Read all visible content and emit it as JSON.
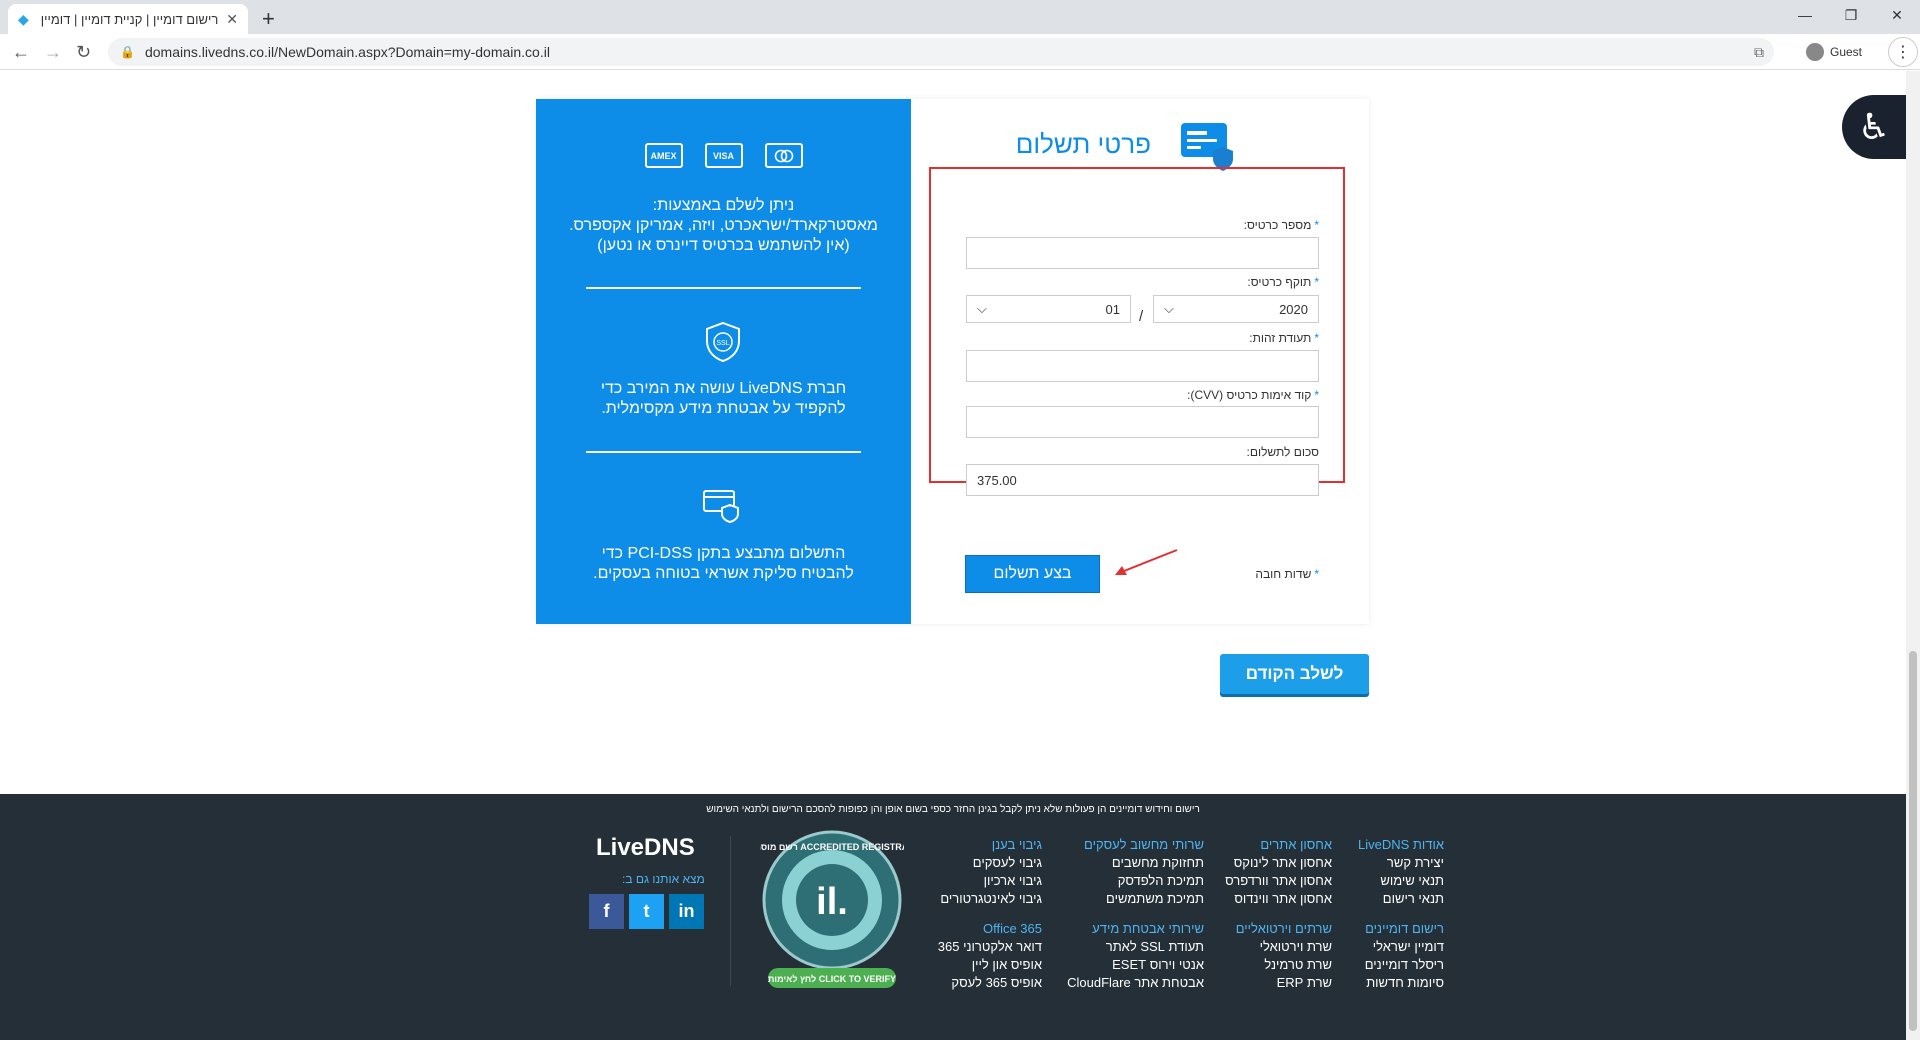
{
  "browser": {
    "tab_title": "רישום דומיין | קניית דומיין | דומיין ישראלי",
    "tab_favicon": "livedns-favicon",
    "url": "domains.livedns.co.il/NewDomain.aspx?Domain=my-domain.co.il",
    "profile_label": "Guest"
  },
  "info_panel": {
    "card_logos": [
      "AMEX",
      "VISA",
      "MC"
    ],
    "pay_methods_text": "ניתן לשלם באמצעות:\nמאסטרקארד/ישראכרט, ויזה, אמריקן אקספרס.\n(אין להשתמש בכרטיס דיינרס או נטען)",
    "ssl_label": "SSL",
    "ssl_text": "חברת LiveDNS עושה את המירב כדי\nלהקפיד על אבטחת מידע מקסימלית.",
    "pci_text": "התשלום מתבצע בתקן PCI-DSS כדי\nלהבטיח סליקת אשראי בטוחה בעסקים."
  },
  "form": {
    "title": "פרטי תשלום",
    "card_number_label": "מספר כרטיס:",
    "card_number_value": "",
    "expiry_label": "תוקף כרטיס:",
    "expiry_year": "2020",
    "expiry_month": "01",
    "expiry_separator": "/",
    "id_label": "תעודת זהות:",
    "id_value": "",
    "cvv_label": "קוד אימות כרטיס (CVV):",
    "cvv_value": "",
    "amount_label": "סכום לתשלום:",
    "amount_value": "375.00",
    "submit_label": "בצע תשלום",
    "required_note": "שדות חובה",
    "required_mark": "*"
  },
  "previous_step_label": "לשלב הקודם",
  "colors": {
    "brand_blue": "#0d8ce8",
    "footer_bg": "#242f37",
    "highlight_red": "#e03030"
  },
  "footer": {
    "disclaimer": "רישום וחידוש דומיינים הן פעולות שלא ניתן לקבל בגינן החזר כספי בשום אופן והן כפופות להסכם הרישום ולתנאי השימוש",
    "logo": "LiveDNS",
    "find_us": "מצא אותנו גם ב:",
    "columns": [
      {
        "heading": "אודות LiveDNS",
        "items": [
          "יצירת קשר",
          "תנאי שימוש",
          "תנאי רישום"
        ]
      },
      {
        "heading": "אחסון אתרים",
        "items": [
          "אחסון אתר לינוקס",
          "אחסון אתר וורדפרס",
          "אחסון אתר ווינדוס"
        ]
      },
      {
        "heading": "שרותי מחשוב לעסקים",
        "items": [
          "תחזוקת מחשבים",
          "תמיכת הלפדסק",
          "תמיכת משתמשים"
        ]
      },
      {
        "heading": "גיבוי בענן",
        "items": [
          "גיבוי לעסקים",
          "גיבוי ארכיון",
          "גיבוי לאינטגרטורים"
        ]
      },
      {
        "heading": "רישום דומיינים",
        "items": [
          "דומיין ישראלי",
          "ריסלר דומיינים",
          "סיומות חדשות"
        ]
      },
      {
        "heading": "שרתים וירטואליים",
        "items": [
          "שרת וירטואלי",
          "שרת טרמינל",
          "שרת ERP"
        ]
      },
      {
        "heading": "שירותי אבטחת מידע",
        "items": [
          "תעודת SSL לאתר",
          "אנטי וירוס ESET",
          "אבטחת אתר CloudFlare"
        ]
      },
      {
        "heading": "Office 365",
        "items": [
          "דואר אלקטרוני 365",
          "אופיס און ליין",
          "אופיס 365 לעסק"
        ]
      }
    ],
    "seal_top": "ACCREDITED REGISTRAR רשם מוסמך",
    "seal_center": ".il",
    "seal_bottom": "CLICK TO VERIFY לחץ לאימות",
    "social": [
      "f",
      "t",
      "in"
    ]
  }
}
